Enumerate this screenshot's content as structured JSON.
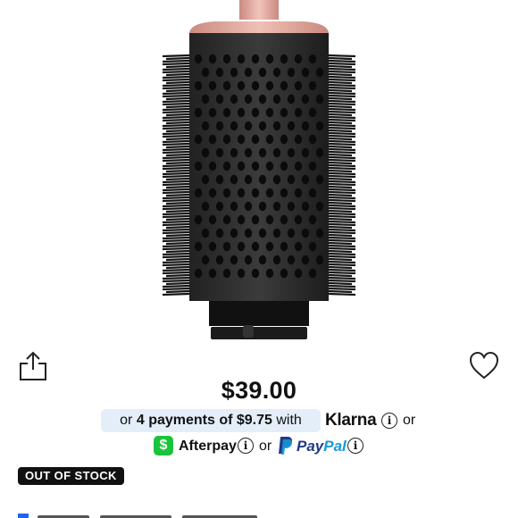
{
  "product": {
    "image_alt": "Round volumising brush attachment",
    "price": "$39.00",
    "stock_status": "OUT OF STOCK"
  },
  "actions": {
    "share_icon": "share-icon",
    "wishlist_icon": "heart-icon"
  },
  "payments": {
    "or_prefix": "or",
    "installments": "4 payments of $9.75",
    "with": "with",
    "klarna_label": "Klarna",
    "or_after_klarna": "or",
    "cashapp_symbol": "$",
    "afterpay_label": "Afterpay",
    "or_after_afterpay": "or",
    "paypal_pay": "Pay",
    "paypal_pal": "Pal",
    "info_symbol": "i"
  },
  "colors": {
    "pill_bg": "#e3eef8",
    "cashapp_green": "#19c33c",
    "paypal_dark": "#1e3a8a",
    "paypal_light": "#179bd7",
    "brush_collar": "#e8b3a9"
  }
}
